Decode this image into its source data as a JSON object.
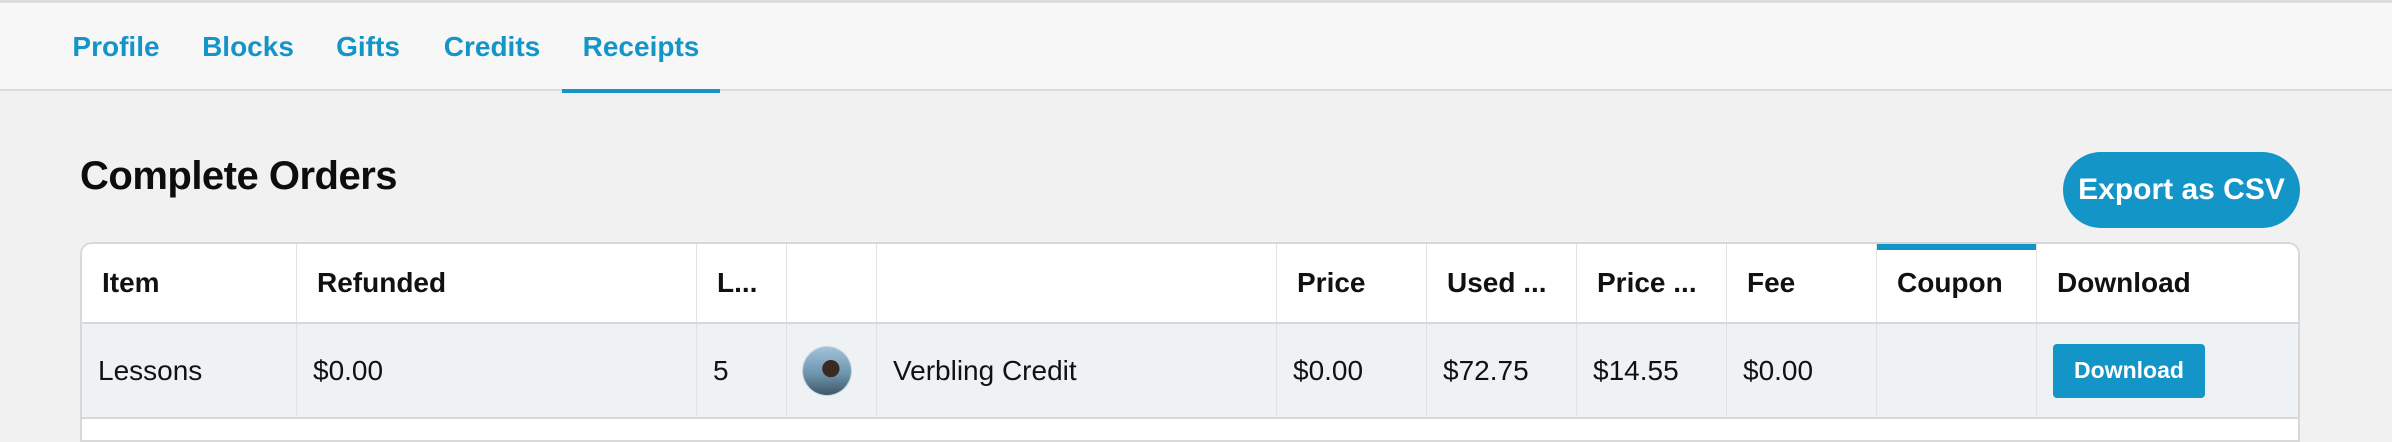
{
  "tabs": [
    {
      "label": "Profile"
    },
    {
      "label": "Blocks"
    },
    {
      "label": "Gifts"
    },
    {
      "label": "Credits"
    },
    {
      "label": "Receipts",
      "active": true
    }
  ],
  "page": {
    "title": "Complete Orders",
    "export_button": "Export as CSV"
  },
  "table": {
    "columns": [
      "Item",
      "Refunded",
      "L...",
      "",
      "",
      "Price",
      "Used ...",
      "Price ...",
      "Fee",
      "Coupon",
      "Download"
    ],
    "rows": [
      {
        "item": "Lessons",
        "refunded": "$0.00",
        "lessons": "5",
        "avatar": "avatar-image",
        "provider": "Verbling Credit",
        "price": "$0.00",
        "used": "$72.75",
        "price_per": "$14.55",
        "fee": "$0.00",
        "coupon": "",
        "download": "Download"
      }
    ]
  },
  "colors": {
    "accent": "#1495c8",
    "background": "#f1f1f1",
    "row_background": "#eef2f4"
  }
}
